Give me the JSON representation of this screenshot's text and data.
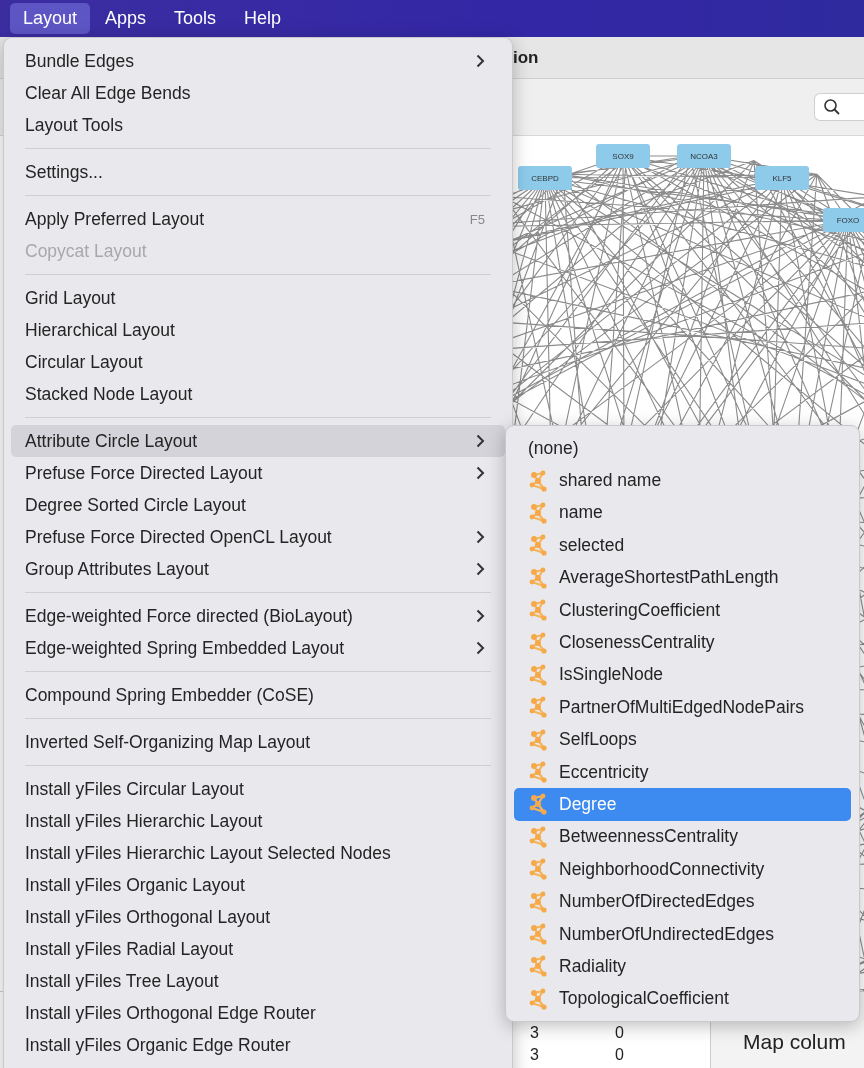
{
  "menu_bar": [
    {
      "label": "Layout",
      "selected": true
    },
    {
      "label": "Apps",
      "selected": false
    },
    {
      "label": "Tools",
      "selected": false
    },
    {
      "label": "Help",
      "selected": false
    }
  ],
  "window": {
    "title": "ion"
  },
  "network": {
    "nodes": [
      {
        "label": "CEBPD"
      },
      {
        "label": "SOX9"
      },
      {
        "label": "NCOA3"
      },
      {
        "label": "KLF5"
      },
      {
        "label": "FOXO"
      }
    ]
  },
  "table": {
    "rows": [
      [
        "3",
        "0"
      ],
      [
        "3",
        "0"
      ]
    ]
  },
  "side_panel": {
    "items": [
      "Map colum"
    ]
  },
  "layout_menu": {
    "items": [
      {
        "kind": "item",
        "label": "Bundle Edges",
        "submenu": true,
        "disabled": false,
        "selected": false
      },
      {
        "kind": "item",
        "label": "Clear All Edge Bends",
        "submenu": false,
        "disabled": false,
        "selected": false
      },
      {
        "kind": "item",
        "label": "Layout Tools",
        "submenu": false,
        "disabled": false,
        "selected": false
      },
      {
        "kind": "separator"
      },
      {
        "kind": "item",
        "label": "Settings...",
        "submenu": false,
        "disabled": false,
        "selected": false
      },
      {
        "kind": "separator"
      },
      {
        "kind": "item",
        "label": "Apply Preferred Layout",
        "shortcut": "F5",
        "submenu": false,
        "disabled": false,
        "selected": false
      },
      {
        "kind": "item",
        "label": "Copycat Layout",
        "submenu": false,
        "disabled": true,
        "selected": false
      },
      {
        "kind": "separator"
      },
      {
        "kind": "item",
        "label": "Grid Layout",
        "submenu": false,
        "disabled": false,
        "selected": false
      },
      {
        "kind": "item",
        "label": "Hierarchical Layout",
        "submenu": false,
        "disabled": false,
        "selected": false
      },
      {
        "kind": "item",
        "label": "Circular Layout",
        "submenu": false,
        "disabled": false,
        "selected": false
      },
      {
        "kind": "item",
        "label": "Stacked Node Layout",
        "submenu": false,
        "disabled": false,
        "selected": false
      },
      {
        "kind": "separator"
      },
      {
        "kind": "item",
        "label": "Attribute Circle Layout",
        "submenu": true,
        "disabled": false,
        "selected": true
      },
      {
        "kind": "item",
        "label": "Prefuse Force Directed Layout",
        "submenu": true,
        "disabled": false,
        "selected": false
      },
      {
        "kind": "item",
        "label": "Degree Sorted Circle Layout",
        "submenu": false,
        "disabled": false,
        "selected": false
      },
      {
        "kind": "item",
        "label": "Prefuse Force Directed OpenCL Layout",
        "submenu": true,
        "disabled": false,
        "selected": false
      },
      {
        "kind": "item",
        "label": "Group Attributes Layout",
        "submenu": true,
        "disabled": false,
        "selected": false
      },
      {
        "kind": "separator"
      },
      {
        "kind": "item",
        "label": "Edge-weighted Force directed (BioLayout)",
        "submenu": true,
        "disabled": false,
        "selected": false
      },
      {
        "kind": "item",
        "label": "Edge-weighted Spring Embedded Layout",
        "submenu": true,
        "disabled": false,
        "selected": false
      },
      {
        "kind": "separator"
      },
      {
        "kind": "item",
        "label": "Compound Spring Embedder (CoSE)",
        "submenu": false,
        "disabled": false,
        "selected": false
      },
      {
        "kind": "separator"
      },
      {
        "kind": "item",
        "label": "Inverted Self-Organizing Map Layout",
        "submenu": false,
        "disabled": false,
        "selected": false
      },
      {
        "kind": "separator"
      },
      {
        "kind": "item",
        "label": "Install yFiles Circular Layout",
        "submenu": false,
        "disabled": false,
        "selected": false
      },
      {
        "kind": "item",
        "label": "Install yFiles Hierarchic Layout",
        "submenu": false,
        "disabled": false,
        "selected": false
      },
      {
        "kind": "item",
        "label": "Install yFiles Hierarchic Layout Selected Nodes",
        "submenu": false,
        "disabled": false,
        "selected": false
      },
      {
        "kind": "item",
        "label": "Install yFiles Organic Layout",
        "submenu": false,
        "disabled": false,
        "selected": false
      },
      {
        "kind": "item",
        "label": "Install yFiles Orthogonal Layout",
        "submenu": false,
        "disabled": false,
        "selected": false
      },
      {
        "kind": "item",
        "label": "Install yFiles Radial Layout",
        "submenu": false,
        "disabled": false,
        "selected": false
      },
      {
        "kind": "item",
        "label": "Install yFiles Tree Layout",
        "submenu": false,
        "disabled": false,
        "selected": false
      },
      {
        "kind": "item",
        "label": "Install yFiles Orthogonal Edge Router",
        "submenu": false,
        "disabled": false,
        "selected": false
      },
      {
        "kind": "item",
        "label": "Install yFiles Organic Edge Router",
        "submenu": false,
        "disabled": false,
        "selected": false
      }
    ]
  },
  "submenu": {
    "items": [
      {
        "kind": "none",
        "label": "(none)",
        "selected": false
      },
      {
        "kind": "attribute",
        "label": "shared name",
        "selected": false
      },
      {
        "kind": "attribute",
        "label": "name",
        "selected": false
      },
      {
        "kind": "attribute",
        "label": "selected",
        "selected": false
      },
      {
        "kind": "attribute",
        "label": "AverageShortestPathLength",
        "selected": false
      },
      {
        "kind": "attribute",
        "label": "ClusteringCoefficient",
        "selected": false
      },
      {
        "kind": "attribute",
        "label": "ClosenessCentrality",
        "selected": false
      },
      {
        "kind": "attribute",
        "label": "IsSingleNode",
        "selected": false
      },
      {
        "kind": "attribute",
        "label": "PartnerOfMultiEdgedNodePairs",
        "selected": false
      },
      {
        "kind": "attribute",
        "label": "SelfLoops",
        "selected": false
      },
      {
        "kind": "attribute",
        "label": "Eccentricity",
        "selected": false
      },
      {
        "kind": "attribute",
        "label": "Degree",
        "selected": true
      },
      {
        "kind": "attribute",
        "label": "BetweennessCentrality",
        "selected": false
      },
      {
        "kind": "attribute",
        "label": "NeighborhoodConnectivity",
        "selected": false
      },
      {
        "kind": "attribute",
        "label": "NumberOfDirectedEdges",
        "selected": false
      },
      {
        "kind": "attribute",
        "label": "NumberOfUndirectedEdges",
        "selected": false
      },
      {
        "kind": "attribute",
        "label": "Radiality",
        "selected": false
      },
      {
        "kind": "attribute",
        "label": "TopologicalCoefficient",
        "selected": false
      }
    ]
  }
}
